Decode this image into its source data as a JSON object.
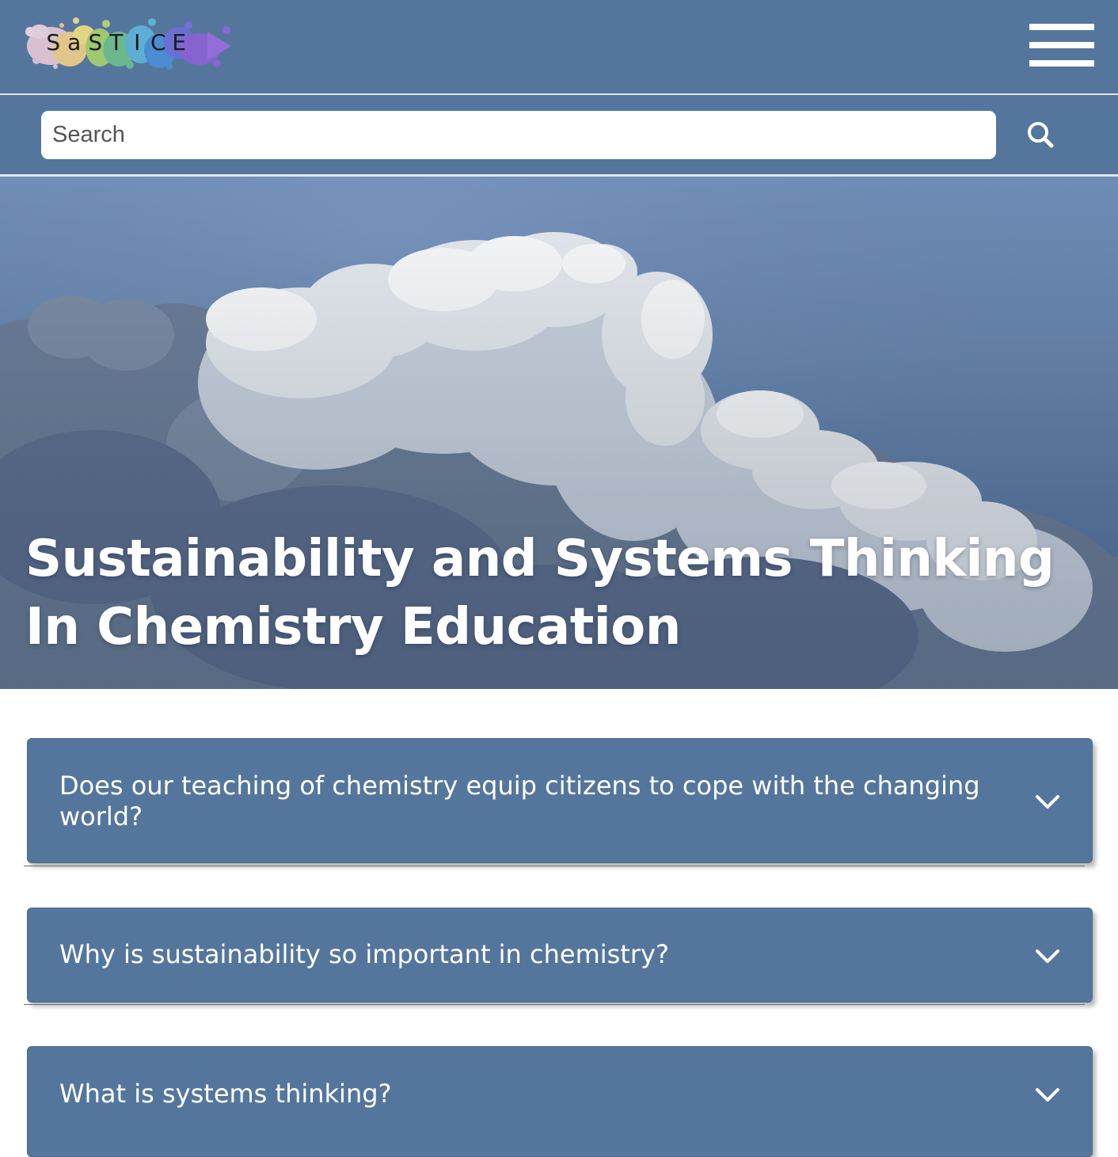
{
  "header": {
    "logo_letters": [
      "S",
      "a",
      "S",
      "T",
      "I",
      "C",
      "E"
    ],
    "menu_icon": "hamburger-menu-icon"
  },
  "search": {
    "placeholder": "Search",
    "value": "",
    "icon": "search-icon"
  },
  "hero": {
    "title": "Sustainability and Systems Thinking In Chemistry Education"
  },
  "faq": {
    "items": [
      {
        "question": "Does our teaching of chemistry equip citizens to cope with the changing world?"
      },
      {
        "question": "Why is sustainability so important in chemistry?"
      },
      {
        "question": "What is systems thinking?"
      }
    ],
    "toggle_icon": "chevron-down-icon"
  },
  "colors": {
    "brand_blue": "#55769c",
    "text_on_brand": "#ffffff",
    "page_background": "#ffffff"
  }
}
